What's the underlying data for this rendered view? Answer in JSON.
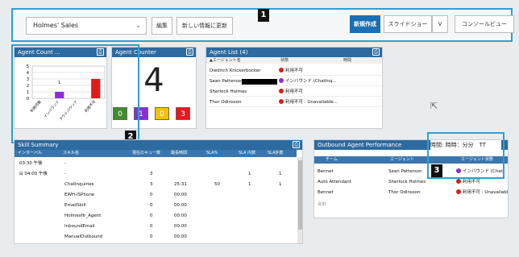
{
  "toolbar": {
    "dashboard_select": "Holmes' Sales",
    "edit": "編集",
    "refresh": "新しい情報に更新",
    "new": "新規作成",
    "slideshow": "スライドショー",
    "slideshow_dd": "V",
    "console": "コンソールビュー"
  },
  "badges": {
    "one": "1",
    "two": "2",
    "three": "3"
  },
  "agent_count_panel": {
    "title": "Agent Count ...",
    "y_ticks": [
      "5",
      "4",
      "3",
      "2",
      "1",
      "0"
    ],
    "x_labels": [
      "利用可能",
      "インバウンド",
      "アウトバウンド",
      "利用不可"
    ],
    "bar_label": "1"
  },
  "chart_data": {
    "type": "bar",
    "title": "",
    "categories": [
      "利用可能",
      "インバウンド",
      "アウトバウンド",
      "利用不可"
    ],
    "values": [
      0,
      1,
      0,
      3
    ],
    "colors": [
      "#2e8b2e",
      "#8a2ed6",
      "#f2c200",
      "#e01b1b"
    ],
    "ylim": [
      0,
      5
    ],
    "xlabel": "",
    "ylabel": ""
  },
  "agent_counter_panel": {
    "title": "Agent Counter",
    "total": "4",
    "boxes": [
      {
        "value": "0",
        "color": "#3f8c2b"
      },
      {
        "value": "1",
        "color": "#8a2ed6"
      },
      {
        "value": "0",
        "color": "#f2c200"
      },
      {
        "value": "3",
        "color": "#e01b1b"
      }
    ]
  },
  "agent_list_panel": {
    "title": "Agent List (4)",
    "headers": [
      "エージェント名",
      "状態",
      "時間"
    ],
    "rows": [
      {
        "name": "Diedrich Knickerbocker",
        "status": "利用不可",
        "status_color": "red",
        "time": ""
      },
      {
        "name": "Sean Patterson",
        "status": "インバウンド (ChatInq...",
        "status_color": "purple",
        "time": ""
      },
      {
        "name": "Sherlock Holmes",
        "status": "利用不可",
        "status_color": "red",
        "time": ""
      },
      {
        "name": "Thor Odinsson",
        "status": "利用不可 : Unavailable...",
        "status_color": "red",
        "time": ""
      }
    ]
  },
  "skill_summary_panel": {
    "title": "Skill Summary",
    "headers": [
      "インターバル",
      "スキル名",
      "現在のキュー数",
      "最長時間",
      "SLA%",
      "SLA 内数",
      "SLA外数"
    ],
    "rows": [
      {
        "interval": "03:30 午後",
        "skill": "-",
        "queue": "",
        "longest": "",
        "sla": "",
        "in": "",
        "out": ""
      },
      {
        "interval": "⊟ 04:00 午後",
        "skill": "-",
        "queue": "3",
        "longest": "",
        "sla": "",
        "in": "1",
        "out": "1"
      },
      {
        "interval": "",
        "skill": "ChatInquiries",
        "queue": "3",
        "longest": "25:31",
        "sla": "50",
        "in": "1",
        "out": "1"
      },
      {
        "interval": "",
        "skill": "EWH-ISPhone",
        "queue": "0",
        "longest": "00:00",
        "sla": "",
        "in": "",
        "out": ""
      },
      {
        "interval": "",
        "skill": "EmailSkill",
        "queue": "0",
        "longest": "00:00",
        "sla": "",
        "in": "",
        "out": ""
      },
      {
        "interval": "",
        "skill": "Holmesfir_Agent",
        "queue": "0",
        "longest": "00:00",
        "sla": "",
        "in": "",
        "out": ""
      },
      {
        "interval": "",
        "skill": "InboundEmail",
        "queue": "0",
        "longest": "00:00",
        "sla": "",
        "in": "",
        "out": ""
      },
      {
        "interval": "",
        "skill": "ManualOutbound",
        "queue": "0",
        "longest": "00:00",
        "sla": "",
        "in": "",
        "out": ""
      }
    ]
  },
  "outbound_panel": {
    "title": "Outbound Agent Performance",
    "time_format": "時間: 時時：分分　TT",
    "headers": [
      "チーム",
      "エージェント",
      "エージェント状態"
    ],
    "rows": [
      {
        "team": "Bennet",
        "agent": "Sean Patterson",
        "state": "インバウンド (Chat",
        "state_color": "purple"
      },
      {
        "team": "Auto Attendant",
        "agent": "Sherlock Holmes",
        "state": "利用不可",
        "state_color": "red"
      },
      {
        "team": "Bennet",
        "agent": "Thor Odinsson",
        "state": "利用不可 : Unavailable",
        "state_color": "red"
      }
    ],
    "total_label": "合計"
  }
}
